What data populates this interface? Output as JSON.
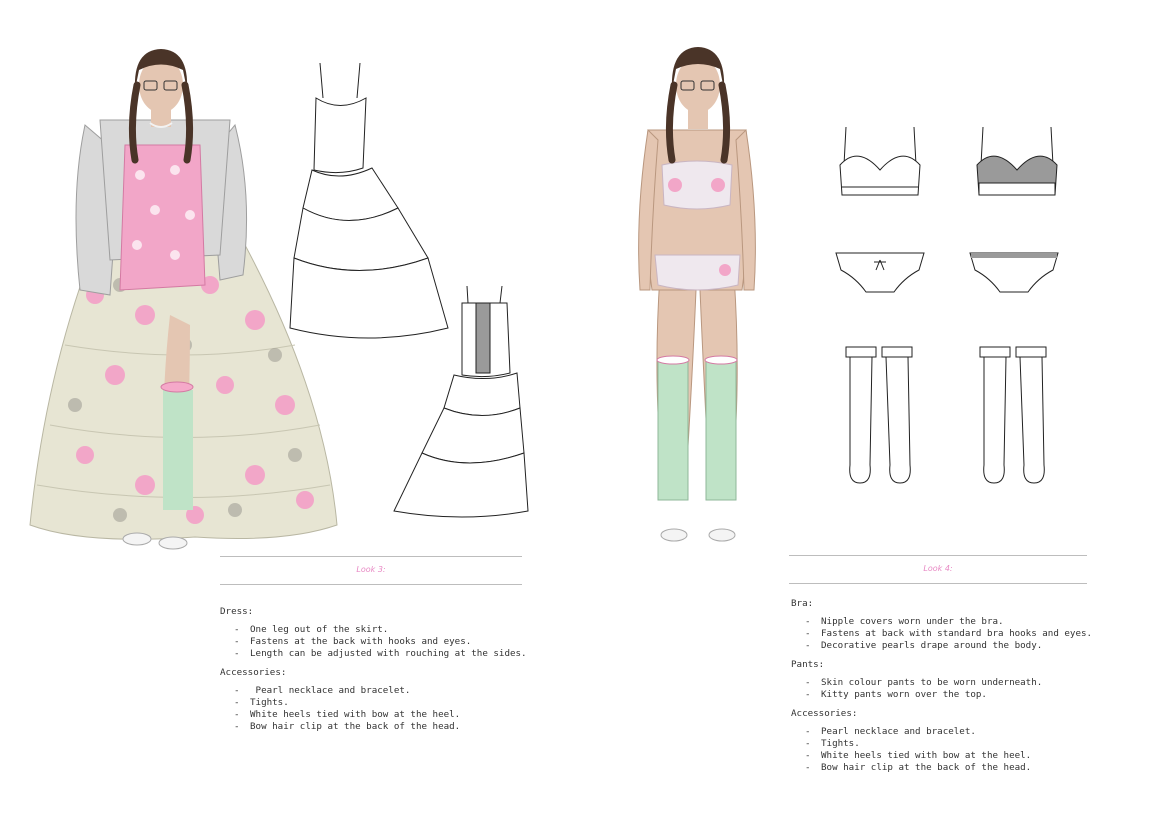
{
  "looks": [
    {
      "title": "Look 3:",
      "sections": [
        {
          "label": "Dress:",
          "items": [
            "One leg out of the skirt.",
            "Fastens at the back with hooks and eyes.",
            "Length can be adjusted with rouching at the sides."
          ]
        },
        {
          "label": "Accessories:",
          "items": [
            " Pearl necklace and bracelet.",
            "Tights.",
            "White heels tied with bow at the heel.",
            "Bow hair clip at the back of the head."
          ]
        }
      ]
    },
    {
      "title": "Look 4:",
      "sections": [
        {
          "label": "Bra:",
          "items": [
            "Nipple covers worn under the bra.",
            "Fastens at back with standard bra hooks and eyes.",
            "Decorative pearls drape around the body."
          ]
        },
        {
          "label": "Pants:",
          "items": [
            "Skin colour pants to be worn underneath.",
            "Kitty pants worn over the top."
          ]
        },
        {
          "label": "Accessories:",
          "items": [
            "Pearl necklace and bracelet.",
            "Tights.",
            "White heels tied with bow at the heel.",
            "Bow hair clip at the back of the head."
          ]
        }
      ]
    }
  ],
  "colors": {
    "accent_pink": "#e889c4",
    "rule": "#bdbdbd",
    "skin": "#e4c6b2",
    "hair": "#4a3428",
    "skirt": "#e7e5d3",
    "print_pink": "#f2a6c8",
    "cardigan": "#d9d9d9",
    "sock_mint": "#bfe3c7"
  }
}
